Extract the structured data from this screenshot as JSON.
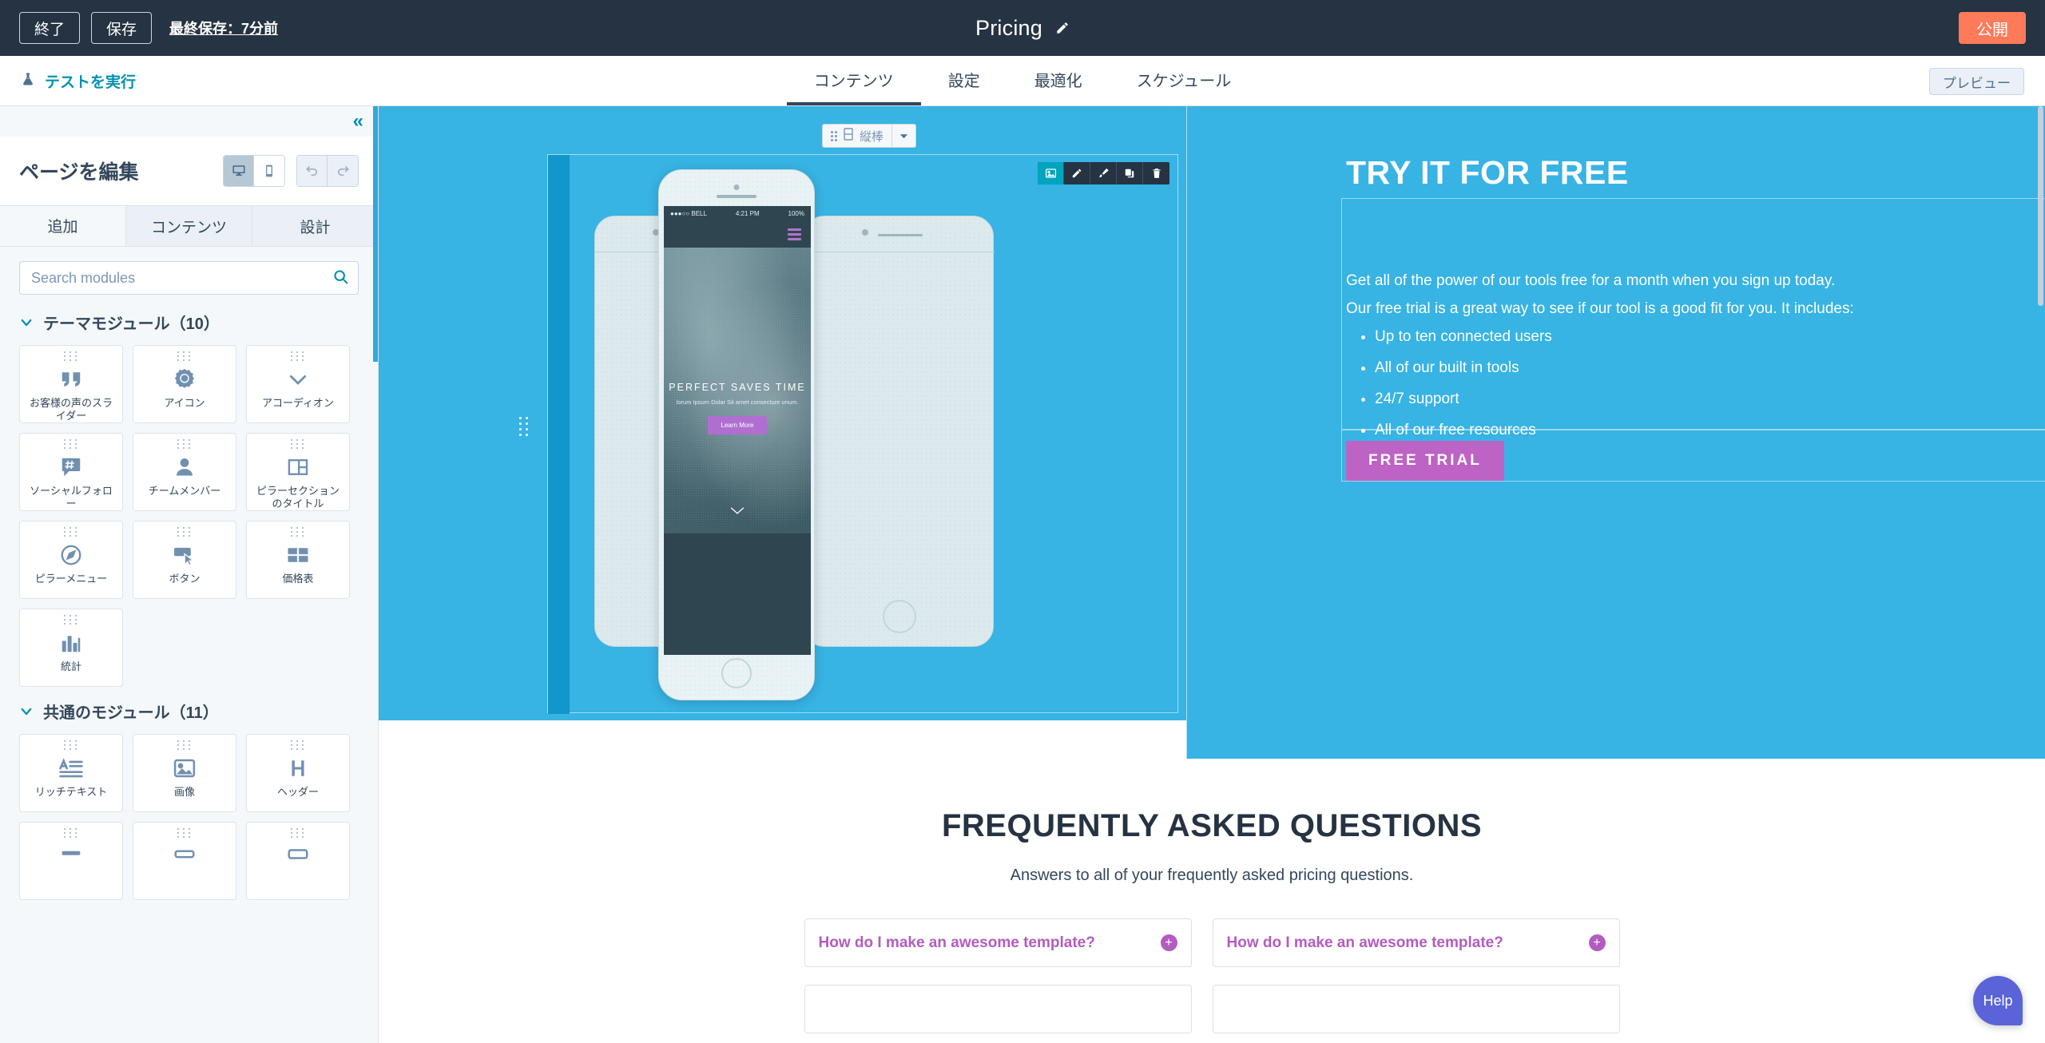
{
  "topbar": {
    "exit_label": "終了",
    "save_label": "保存",
    "last_saved": "最終保存：7分前",
    "page_title": "Pricing",
    "edit_title_icon": "pencil-icon",
    "publish_label": "公開"
  },
  "subbar": {
    "run_test_label": "テストを実行",
    "run_test_icon": "flask-icon",
    "tabs": [
      {
        "label": "コンテンツ",
        "active": true
      },
      {
        "label": "設定",
        "active": false
      },
      {
        "label": "最適化",
        "active": false
      },
      {
        "label": "スケジュール",
        "active": false
      }
    ],
    "preview_label": "プレビュー"
  },
  "left_panel": {
    "collapse_icon": "chevron-double-left-icon",
    "title": "ページを編集",
    "device_desktop_icon": "desktop-icon",
    "device_mobile_icon": "mobile-icon",
    "undo_icon": "undo-icon",
    "redo_icon": "redo-icon",
    "tabs": [
      {
        "label": "追加",
        "active": true
      },
      {
        "label": "コンテンツ",
        "active": false
      },
      {
        "label": "設計",
        "active": false
      }
    ],
    "search": {
      "placeholder": "Search modules",
      "value": "",
      "icon": "search-icon"
    },
    "groups": [
      {
        "title": "テーマモジュール（10）",
        "modules": [
          {
            "label": "お客様の声のスライダー",
            "icon": "quote-icon"
          },
          {
            "label": "アイコン",
            "icon": "badge-icon"
          },
          {
            "label": "アコーディオン",
            "icon": "chevron-down-icon"
          },
          {
            "label": "ソーシャルフォロー",
            "icon": "hashtag-chat-icon"
          },
          {
            "label": "チームメンバー",
            "icon": "person-icon"
          },
          {
            "label": "ピラーセクションのタイトル",
            "icon": "layout-columns-icon"
          },
          {
            "label": "ピラーメニュー",
            "icon": "compass-icon"
          },
          {
            "label": "ボタン",
            "icon": "button-cursor-icon"
          },
          {
            "label": "価格表",
            "icon": "table-icon"
          },
          {
            "label": "統計",
            "icon": "bar-chart-icon"
          }
        ]
      },
      {
        "title": "共通のモジュール（11）",
        "modules": [
          {
            "label": "リッチテキスト",
            "icon": "rich-text-icon"
          },
          {
            "label": "画像",
            "icon": "image-icon"
          },
          {
            "label": "ヘッダー",
            "icon": "heading-icon"
          }
        ]
      }
    ]
  },
  "canvas": {
    "section_toolbar": {
      "drag_icon": "drag-dots-icon",
      "layout_icon": "column-layout-icon",
      "label": "縦棒",
      "caret_icon": "chevron-down-icon"
    },
    "module_toolbar": {
      "buttons": [
        {
          "icon": "image-icon",
          "active": true
        },
        {
          "icon": "pencil-icon",
          "active": false
        },
        {
          "icon": "paintbrush-icon",
          "active": false
        },
        {
          "icon": "clone-icon",
          "active": false
        },
        {
          "icon": "trash-icon",
          "active": false
        }
      ]
    },
    "phone_mockup": {
      "status_left": "●●●○○ BELL",
      "status_wifi_icon": "wifi-icon",
      "status_time": "4:21 PM",
      "status_bluetooth_icon": "bluetooth-icon",
      "status_battery": "100%",
      "menu_icon": "hamburger-icon",
      "headline": "PERFECT SAVES TIME",
      "subtext": "lorum Ipsum Dolar Sit amet consecture unum.",
      "cta": "Learn More",
      "scroll_icon": "chevron-down-icon"
    },
    "hero_right": {
      "heading": "TRY IT FOR FREE",
      "paragraph_1": "Get all of the power of our tools free for a month when you sign up today.",
      "paragraph_2": "Our free trial is a great way to see if our tool is a good fit for you. It includes:",
      "bullets": [
        "Up to ten connected users",
        "All of our built in tools",
        "24/7 support",
        "All of our free resources"
      ],
      "cta_label": "FREE TRIAL"
    },
    "faq": {
      "heading": "FREQUENTLY ASKED QUESTIONS",
      "subheading": "Answers to all of your frequently asked pricing questions.",
      "items": [
        {
          "question": "How do I make an awesome template?",
          "expand_icon": "plus-circle-icon"
        },
        {
          "question": "How do I make an awesome template?",
          "expand_icon": "plus-circle-icon"
        }
      ]
    }
  },
  "help": {
    "label": "Help"
  },
  "colors": {
    "topbar_bg": "#253342",
    "publish": "#ff7a59",
    "accent_teal": "#0091ae",
    "hero_blue": "#37b3e4",
    "purple": "#b35cc0",
    "free_trial": "#bd63c5",
    "help": "#5a64d8"
  }
}
